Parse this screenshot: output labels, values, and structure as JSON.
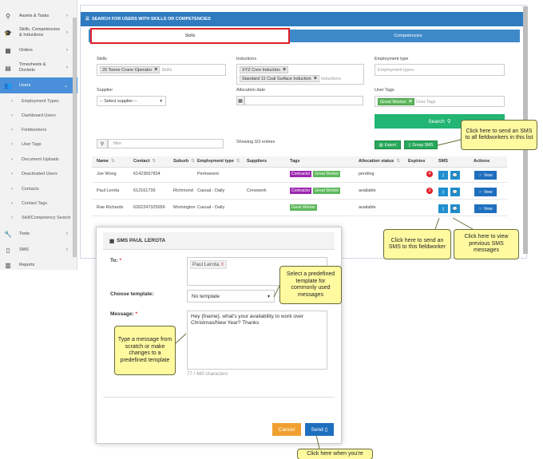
{
  "sidebar": {
    "items": [
      {
        "label": "Assets & Tasks",
        "icon": "bicycle-icon"
      },
      {
        "label": "Skills, Competencies & Inductions",
        "icon": "graduation-cap-icon"
      },
      {
        "label": "Orders",
        "icon": "calendar-icon"
      },
      {
        "label": "Timesheets & Dockets",
        "icon": "table-icon"
      },
      {
        "label": "Users",
        "icon": "users-icon"
      }
    ],
    "subitems": [
      "Employment Types",
      "Dashboard Users",
      "Fieldworkers",
      "User Tags",
      "Document Uploads",
      "Deactivated Users",
      "Contacts",
      "Contact Tags",
      "Skill/Competency Search"
    ],
    "bottom": [
      {
        "label": "Tools",
        "icon": "wrench-icon"
      },
      {
        "label": "SMS",
        "icon": "mobile-icon"
      },
      {
        "label": "Reports",
        "icon": "chart-icon"
      }
    ]
  },
  "panel": {
    "title": "SEARCH FOR USERS WITH SKILLS OR COMPETENCIES",
    "tabs": {
      "skills": "Skills",
      "competencies": "Competencies"
    }
  },
  "form": {
    "skills_label": "Skills",
    "skills_chip": "20 Tonne Crane Operator",
    "skills_placeholder": "Skills",
    "inductions_label": "Inductions",
    "induction_chips": [
      "XYZ Core Induction",
      "Standard 11 Coal Surface Induction"
    ],
    "inductions_placeholder": "Inductions",
    "employment_label": "Employment type",
    "employment_placeholder": "Employment types",
    "supplier_label": "Supplier",
    "supplier_value": "-- Select supplier --",
    "allocation_label": "Allocation date",
    "user_tags_label": "User Tags",
    "user_tag_chip": "Great Worker",
    "user_tags_placeholder": "User Tags",
    "search_button": "Search",
    "export_button": "Export",
    "group_sms_button": "Group SMS"
  },
  "table": {
    "filter_placeholder": "filter",
    "showing": "Showing 3/3 entries",
    "headers": [
      "Name",
      "Contact",
      "Suburb",
      "Employment type",
      "Suppliers",
      "Tags",
      "Allocation status",
      "Expiries",
      "SMS",
      "Actions"
    ],
    "rows": [
      {
        "name": "Joe Wong",
        "contact": "61423567834",
        "suburb": "",
        "employment": "Permanent",
        "supplier": "",
        "tags": [
          "Contractor",
          "Great Worker"
        ],
        "status": "pending",
        "expiries": "4"
      },
      {
        "name": "Paul Lerota",
        "contact": "612161739",
        "suburb": "Richmond",
        "employment": "Casual - Daily",
        "supplier": "Crewwork",
        "tags": [
          "Contractor",
          "Great Worker"
        ],
        "status": "available",
        "expiries": "3"
      },
      {
        "name": "Rae Richards",
        "contact": "6262247325656",
        "suburb": "Mornington",
        "employment": "Casual - Daily",
        "supplier": "",
        "tags": [
          "Great Worker"
        ],
        "status": "available",
        "expiries": ""
      }
    ],
    "view_label": "View"
  },
  "callouts": {
    "group_sms": "Click here to send an SMS to all fieldworkers in this list",
    "send_sms": "Click here to send an SMS to this fieldworker",
    "view_sms": "Click here to view previous SMS messages",
    "template": "Select a predefined template for commonly used messages",
    "type_message": "Type a message from scratch or make changes to a predefined template",
    "send": "Click here when you're"
  },
  "modal": {
    "title": "SMS PAUL LEROTA",
    "to_label": "To:",
    "to_chip": "Paul Lerota",
    "template_label": "Choose template:",
    "template_value": "No template",
    "message_label": "Message:",
    "message_text": "Hey {fname}, what's your availability to work over Christmas/New Year? Thanks",
    "char_count": "77 / 480 characters",
    "cancel": "Cancel",
    "send": "Send"
  },
  "colors": {
    "primary": "#2f7bbf",
    "success": "#22b573",
    "danger": "#e0202a",
    "callout": "#fffaa0"
  }
}
